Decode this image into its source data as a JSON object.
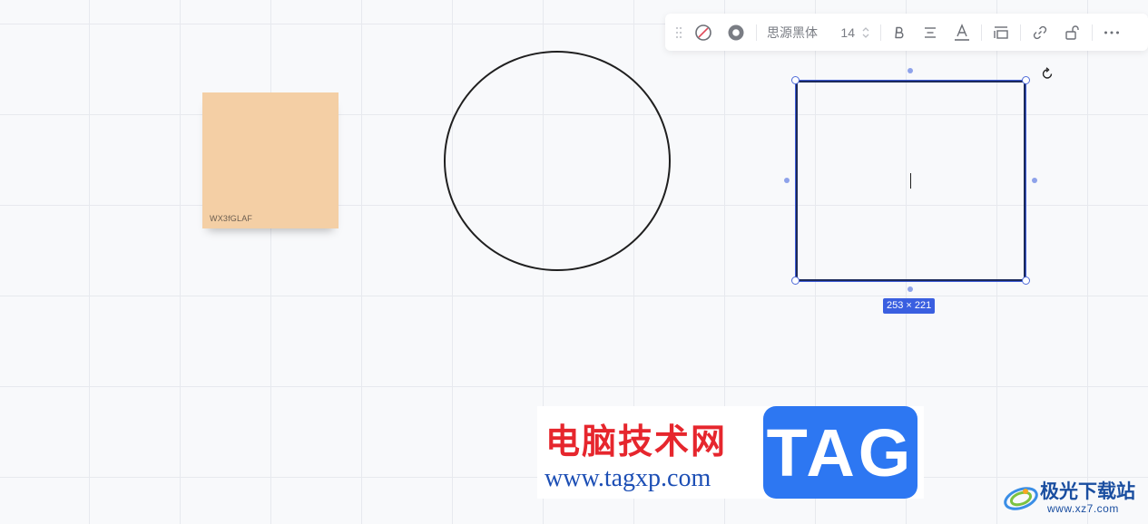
{
  "canvas": {
    "sticky_note": {
      "label": "WX3fGLAF",
      "color": "#f4cfa5"
    },
    "rectangle": {
      "size_label": "253 × 221",
      "selection_color": "#3a5fe0"
    }
  },
  "toolbar": {
    "font_name": "思源黑体",
    "font_size": "14",
    "icons": [
      "drag-handle-icon",
      "no-fill-icon",
      "stroke-icon",
      "stepper-icon",
      "bold-icon",
      "align-center-icon",
      "text-color-icon",
      "layer-icon",
      "link-icon",
      "unlock-icon",
      "more-icon"
    ]
  },
  "watermark": {
    "title": "电脑技术网",
    "url": "www.tagxp.com",
    "tag": "TAG",
    "site2_name": "极光下载站",
    "site2_url": "www.xz7.com",
    "title_color": "#e6262d",
    "tag_color": "#2d77f2"
  }
}
